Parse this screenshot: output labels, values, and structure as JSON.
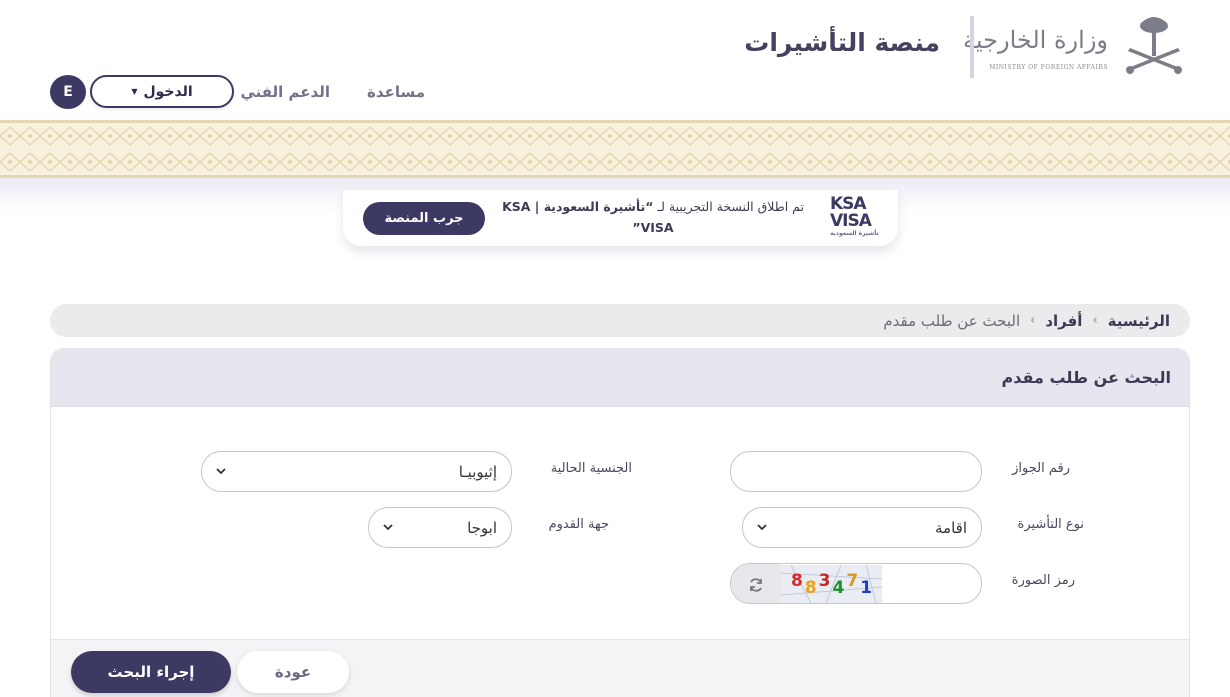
{
  "header": {
    "ministry_ar": "وزارة الخارجية",
    "ministry_en": "MINISTRY OF FOREIGN AFFAIRS",
    "platform_title": "منصة التأشيرات",
    "nav": {
      "help": "مساعدة",
      "support": "الدعم الفني",
      "login": "الدخول",
      "language": "E"
    }
  },
  "notice": {
    "logo_line1": "KSA",
    "logo_line2": "VISA",
    "logo_sub": "تأشيرة السعودية",
    "text_prefix": "تم اطلاق النسخة التجريبية لـ ",
    "text_bold": "“تأشيرة السعودية | KSA VISA”",
    "button": "جرب المنصة"
  },
  "breadcrumb": {
    "home": "الرئيسية",
    "individuals": "أفراد",
    "current": "البحث عن طلب مقدم",
    "separator": "›"
  },
  "panel": {
    "title": "البحث عن طلب مقدم",
    "fields": {
      "passport_label": "رقم الجواز",
      "passport_value": "",
      "nationality_label": "الجنسية الحالية",
      "nationality_value": "إثيوبيـا",
      "visa_type_label": "نوع التأشيرة",
      "visa_type_value": "اقامة",
      "arrival_label": "جهة القدوم",
      "arrival_value": "ابوجا",
      "captcha_label": "رمز الصورة",
      "captcha_value": ""
    },
    "captcha": {
      "digits": [
        "8",
        "8",
        "3",
        "4",
        "7",
        "1"
      ],
      "colors": [
        "#d42a2a",
        "#e8a21c",
        "#c0282a",
        "#1b8f2e",
        "#d89a1c",
        "#1f3fbf"
      ]
    },
    "buttons": {
      "search": "إجراء البحث",
      "back": "عودة"
    }
  },
  "colors": {
    "primary": "#3c3962",
    "band": "#f8f1de",
    "band_border": "#e4d6b0"
  },
  "icons": {
    "emblem": "saudi-emblem-icon",
    "caret": "caret-down-icon",
    "chevron": "chevron-down-icon",
    "refresh": "refresh-icon"
  }
}
